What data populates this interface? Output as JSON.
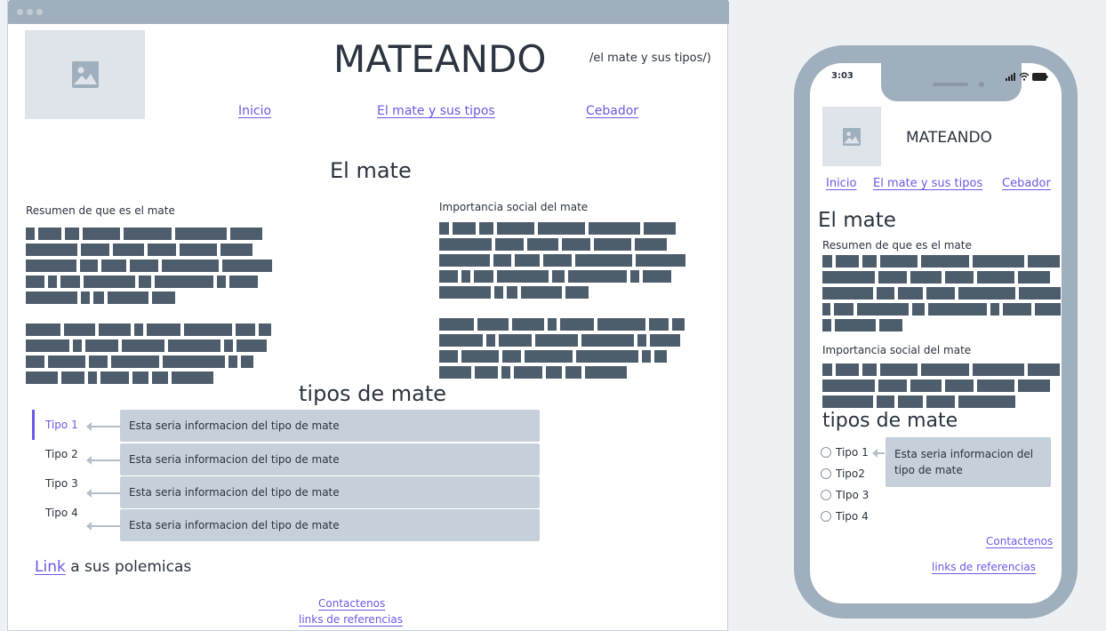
{
  "desktop": {
    "title": "MATEANDO",
    "subtitle": "/el mate y sus tipos/)",
    "nav": [
      "Inicio",
      "El mate y sus tipos",
      "Cebador"
    ],
    "section_title": "El mate",
    "left_heading": "Resumen de que es el mate",
    "right_heading": "Importancia social del mate",
    "tipos_title": "tipos de mate",
    "tipos": [
      {
        "label": "Tipo 1",
        "info": "Esta seria informacion del tipo de mate"
      },
      {
        "label": "Tipo 2",
        "info": "Esta seria informacion del tipo de mate"
      },
      {
        "label": "Tipo 3",
        "info": "Esta seria informacion del tipo de mate"
      },
      {
        "label": "Tipo 4",
        "info": "Esta seria informacion del tipo de mate"
      }
    ],
    "polemicas_link": "Link",
    "polemicas_text": " a sus polemicas",
    "contact": "Contactenos",
    "references": "links de referencias"
  },
  "mobile": {
    "time": "3:03",
    "title": "MATEANDO",
    "nav": [
      "Inicio",
      "El mate y sus tipos",
      "Cebador"
    ],
    "section_title": "El mate",
    "left_heading": "Resumen de que es el mate",
    "right_heading": "Importancia social del mate",
    "tipos_title": "tipos de mate",
    "tipos": [
      "Tipo 1",
      "Tipo2",
      "TIpo 3",
      "Tipo 4"
    ],
    "info": "Esta seria informacion del tipo de mate",
    "contact": "Contactenos",
    "references": "links de referencias"
  },
  "icons": [
    "image-icon",
    "signal-icon",
    "wifi-icon",
    "battery-icon",
    "arrow-left-icon"
  ],
  "colors": {
    "accent": "#6a5ae6",
    "placeholder": "#4e5d6c",
    "frame": "#a0afbd",
    "infobox": "#c5d0da"
  }
}
